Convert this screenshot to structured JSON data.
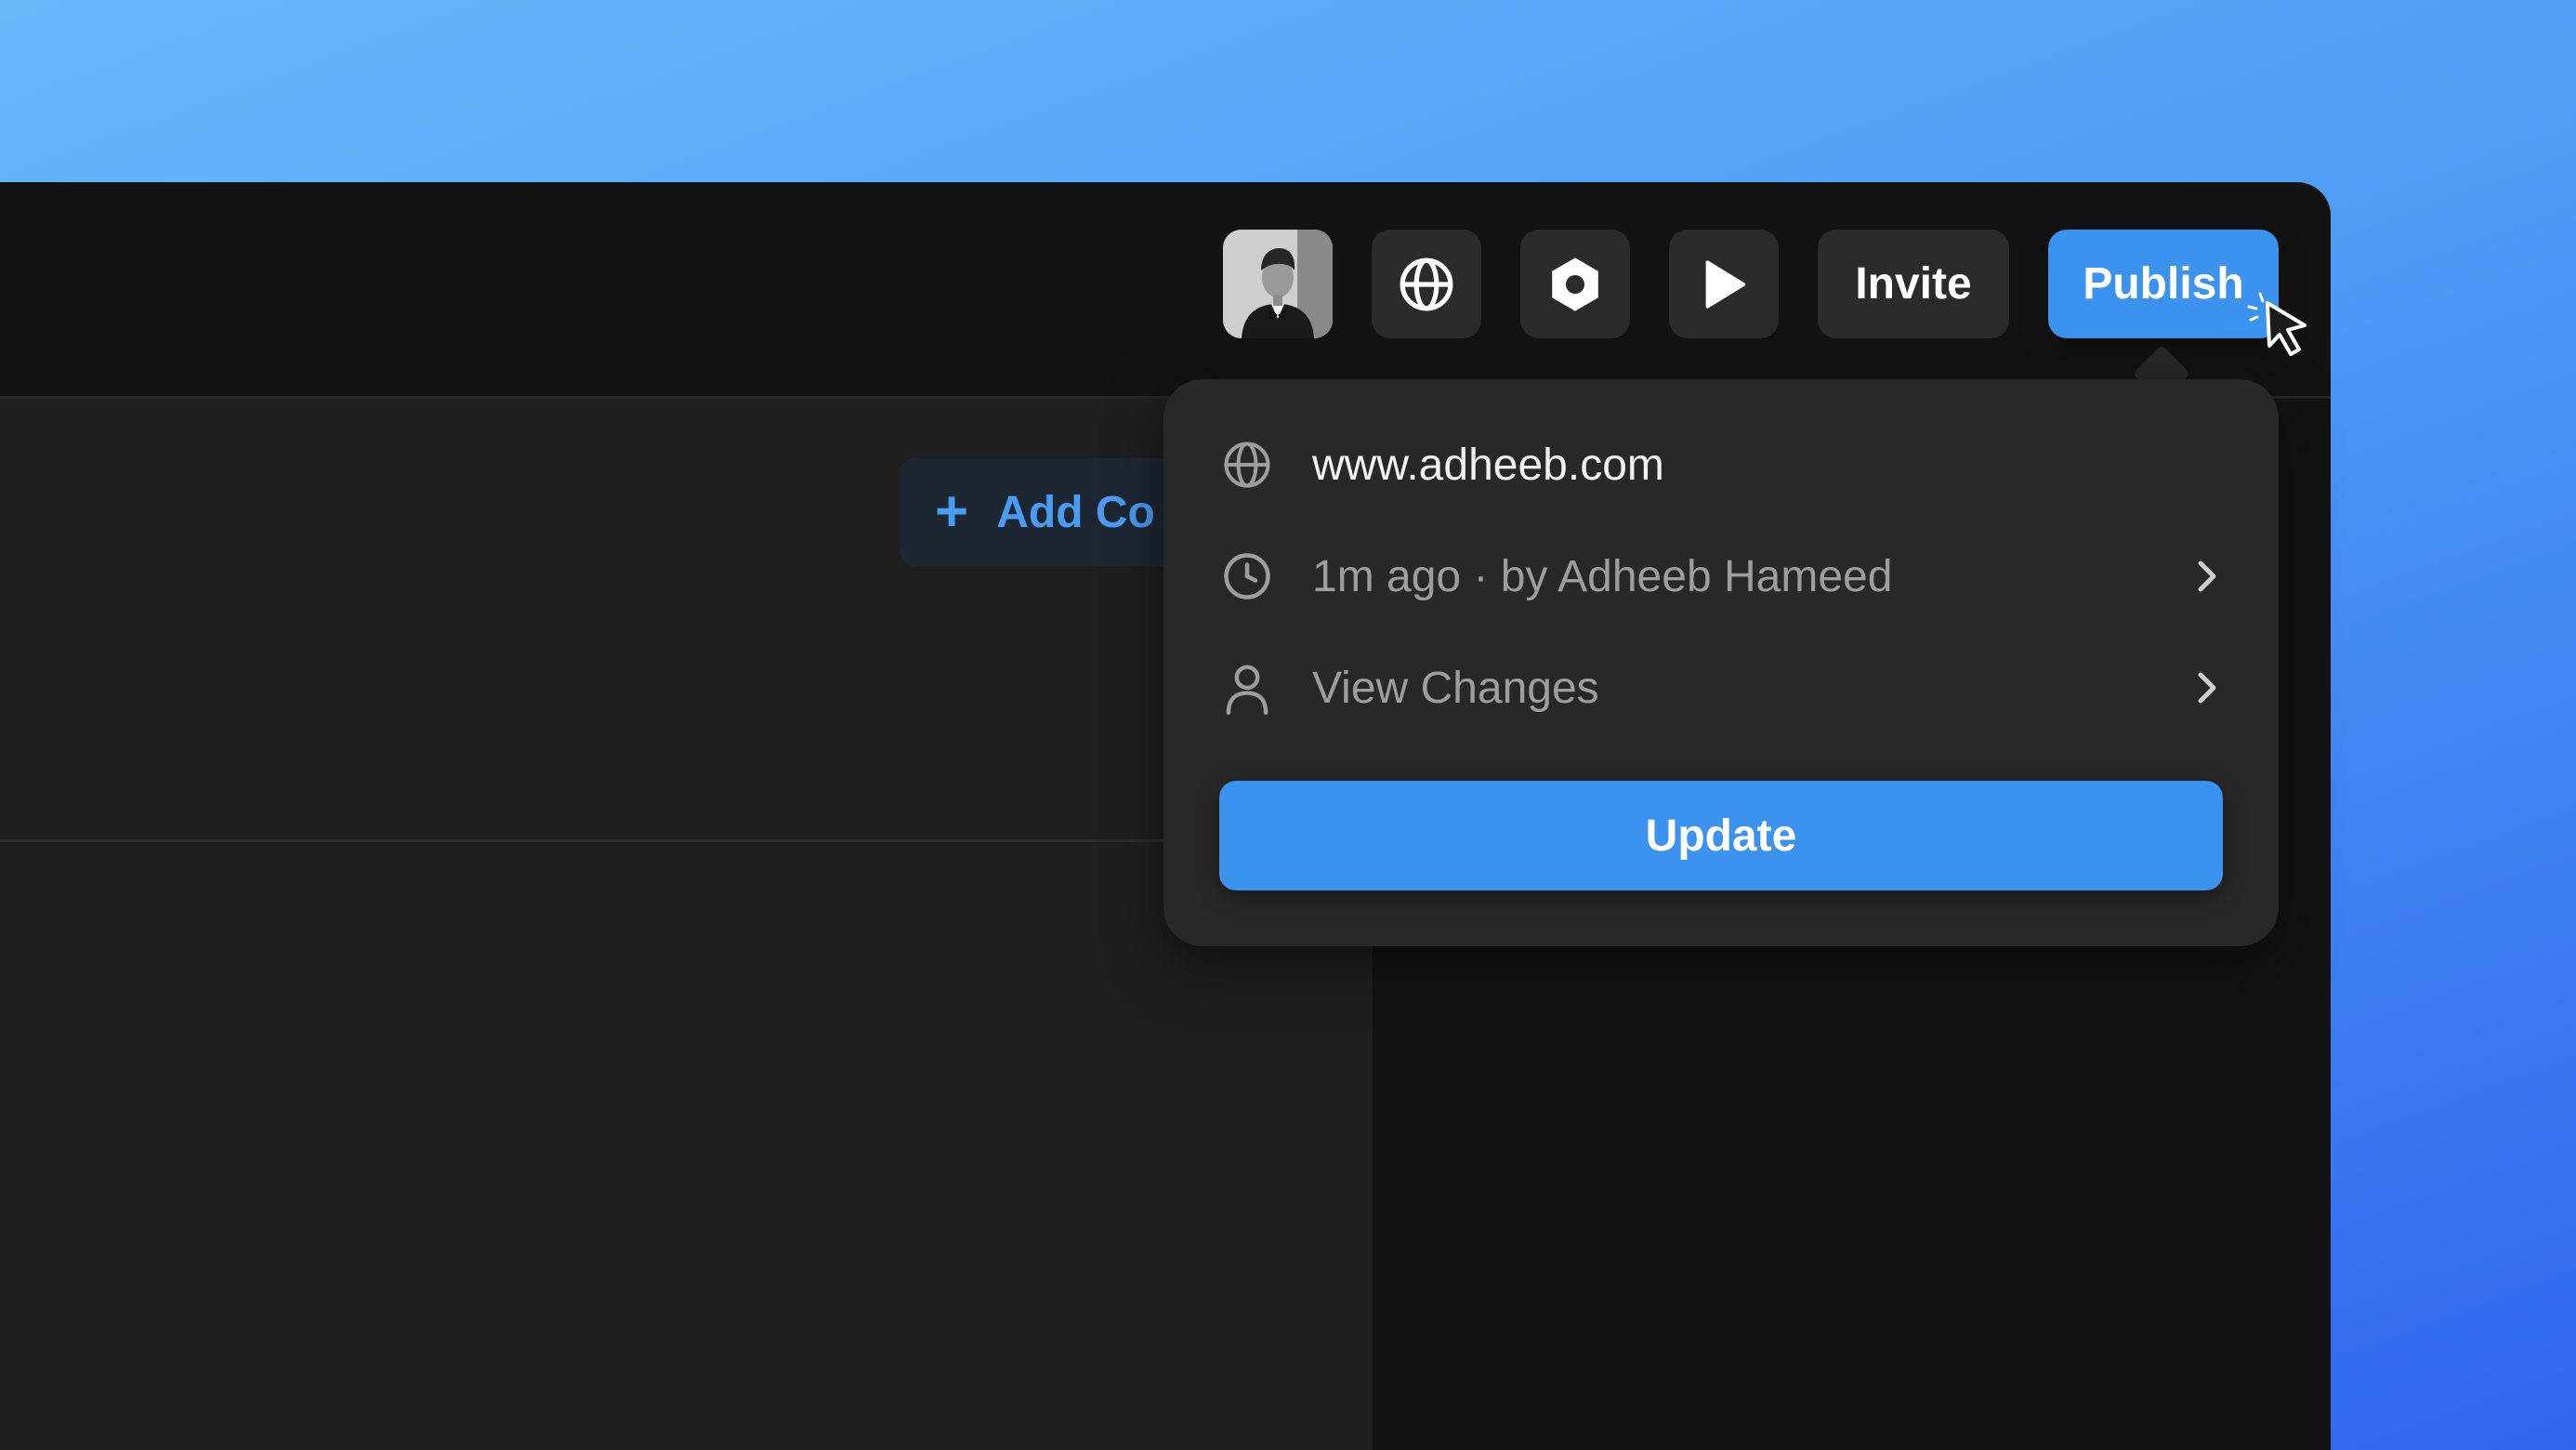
{
  "canvas": {
    "add_button_label": "Add Co",
    "add_button_icon": "plus-icon"
  },
  "toolbar": {
    "avatar_icon": "user-avatar",
    "globe_icon": "globe-icon",
    "settings_icon": "hexagon-settings-icon",
    "play_icon": "play-icon",
    "invite_label": "Invite",
    "publish_label": "Publish"
  },
  "publish_popover": {
    "domain": "www.adheeb.com",
    "last_published": "1m ago · by Adheeb Hameed",
    "view_changes_label": "View Changes",
    "update_label": "Update"
  },
  "colors": {
    "accent": "#3b93ef",
    "window_bg": "#131313",
    "popover_bg": "#282828",
    "button_bg": "#2b2b2b"
  }
}
